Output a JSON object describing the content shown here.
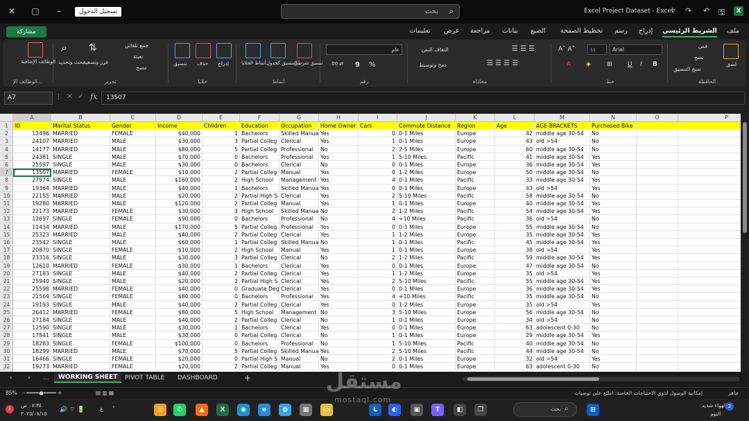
{
  "titlebar": {
    "sign_in": "تسجيل الدخول",
    "search_placeholder": "بحث",
    "doc_title": "Excel Project Dataset  -  Excel",
    "app_icon": "X"
  },
  "menu": {
    "share": "مشاركة",
    "tabs": [
      "ملف",
      "الشريط الرئيسي",
      "إدراج",
      "رسم",
      "تخطيط الصفحة",
      "الصيغ",
      "بيانات",
      "مراجعة",
      "عرض",
      "تعليمات"
    ],
    "active_tab": "الشريط الرئيسي"
  },
  "ribbon": {
    "clipboard": {
      "label": "الحافظة",
      "paste": "لصق",
      "cut": "قص",
      "copy": "نسخ",
      "format_painter": "نسخ التنسيق"
    },
    "font": {
      "label": "خط",
      "font_name": "Arial",
      "font_size": "١١",
      "bold": "B",
      "italic": "I",
      "underline": "U"
    },
    "alignment": {
      "label": "محاذاة",
      "wrap": "التفاف النص",
      "merge": "دمج وتوسيط"
    },
    "number": {
      "label": "رقم",
      "format": "عام",
      "percent": "%",
      "comma": "9"
    },
    "styles": {
      "label": "أنماط",
      "conditional": "تنسيق شرطي",
      "as_table": "التنسيق كجدول",
      "cell_styles": "أنماط الخلايا"
    },
    "cells": {
      "label": "خلايا",
      "insert": "إدراج",
      "delete": "حذف",
      "format": "تنسيق"
    },
    "editing": {
      "label": "تحرير",
      "autosum": "جمع تلقائي",
      "fill": "تعبئة",
      "clear": "مسح",
      "sort": "فرز وتصفية",
      "find": "بحث وتحديد"
    },
    "addins": {
      "label": "الوظائف الإ...",
      "addins": "الوظائف الإضافية"
    }
  },
  "formula_bar": {
    "name_box": "A7",
    "fx": "fx",
    "value": "13507"
  },
  "grid": {
    "columns": [
      "A",
      "B",
      "C",
      "D",
      "E",
      "F",
      "G",
      "H",
      "I",
      "J",
      "K",
      "L",
      "M",
      "N",
      "O",
      "P"
    ],
    "selected_column": "A",
    "selected_row": 7,
    "header_row": [
      "ID",
      "Marital Status",
      "Gender",
      "Income",
      "Children",
      "Education",
      "Occupation",
      "Home Owner",
      "Cars",
      "Commute Distance",
      "Region",
      "Age",
      "AGE-BRACKETS",
      "Purchased Bike"
    ],
    "data_rows": [
      [
        "12496",
        "MARRIED",
        "FEMALE",
        "$40,000",
        "1",
        "Bachelors",
        "Skilled Manua",
        "Yes",
        "0",
        "0-1 Miles",
        "Europe",
        "42",
        "middle age 30-54",
        "No"
      ],
      [
        "24107",
        "MARRIED",
        "MALE",
        "$30,000",
        "3",
        "Partial Colleg",
        "Clerical",
        "Yes",
        "1",
        "0-1 Miles",
        "Europe",
        "43",
        "old >54",
        "No"
      ],
      [
        "14177",
        "MARRIED",
        "MALE",
        "$80,000",
        "5",
        "Partial Colleg",
        "Professional",
        "No",
        "2",
        "2-5 Miles",
        "Europe",
        "60",
        "middle age 30-54",
        "No"
      ],
      [
        "24381",
        "SINGLE",
        "MALE",
        "$70,000",
        "0",
        "Bachelors",
        "Professional",
        "Yes",
        "1",
        "5-10 Miles",
        "Pacific",
        "41",
        "middle age 30-54",
        "Yes"
      ],
      [
        "25597",
        "SINGLE",
        "MALE",
        "$30,000",
        "0",
        "Bachelors",
        "Clerical",
        "No",
        "0",
        "0-1 Miles",
        "Europe",
        "36",
        "middle age 30-54",
        "Yes"
      ],
      [
        "13507",
        "MARRIED",
        "FEMALE",
        "$10,000",
        "2",
        "Partial Colleg",
        "Manual",
        "Yes",
        "0",
        "1-2 Miles",
        "Europe",
        "50",
        "middle age 30-54",
        "No"
      ],
      [
        "27974",
        "SINGLE",
        "MALE",
        "$160,000",
        "2",
        "High School",
        "Management",
        "Yes",
        "4",
        "0-1 Miles",
        "Pacific",
        "33",
        "middle age 30-54",
        "Yes"
      ],
      [
        "19364",
        "MARRIED",
        "MALE",
        "$40,000",
        "1",
        "Bachelors",
        "Skilled Manua",
        "Yes",
        "0",
        "0-1 Miles",
        "Europe",
        "43",
        "old >54",
        "Yes"
      ],
      [
        "22155",
        "MARRIED",
        "MALE",
        "$20,000",
        "2",
        "Partial High S",
        "Clerical",
        "Yes",
        "2",
        "5-10 Miles",
        "Pacific",
        "58",
        "middle age 30-54",
        "No"
      ],
      [
        "19280",
        "MARRIED",
        "MALE",
        "$120,000",
        "2",
        "Partial Colleg",
        "Manual",
        "Yes",
        "1",
        "0-1 Miles",
        "Europe",
        "40",
        "middle age 30-54",
        "Yes"
      ],
      [
        "22173",
        "MARRIED",
        "FEMALE",
        "$30,000",
        "3",
        "High School",
        "Skilled Manua",
        "No",
        "2",
        "1-2 Miles",
        "Pacific",
        "54",
        "middle age 30-54",
        "Yes"
      ],
      [
        "12697",
        "SINGLE",
        "FEMALE",
        "$90,000",
        "0",
        "Bachelors",
        "Professional",
        "No",
        "4",
        "+10 Miles",
        "Pacific",
        "36",
        "old >54",
        "No"
      ],
      [
        "11434",
        "MARRIED",
        "MALE",
        "$170,000",
        "5",
        "Partial Colleg",
        "Professional",
        "Yes",
        "0",
        "0-1 Miles",
        "Europe",
        "55",
        "middle age 30-54",
        "No"
      ],
      [
        "25323",
        "MARRIED",
        "MALE",
        "$40,000",
        "2",
        "Partial Colleg",
        "Clerical",
        "Yes",
        "1",
        "1-2 Miles",
        "Europe",
        "35",
        "middle age 30-54",
        "Yes"
      ],
      [
        "23542",
        "SINGLE",
        "MALE",
        "$60,000",
        "1",
        "Partial Colleg",
        "Skilled Manua",
        "No",
        "1",
        "0-1 Miles",
        "Pacific",
        "45",
        "middle age 30-54",
        "Yes"
      ],
      [
        "20870",
        "SINGLE",
        "FEMALE",
        "$10,000",
        "2",
        "High School",
        "Manual",
        "Yes",
        "1",
        "0-1 Miles",
        "Europe",
        "38",
        "old >54",
        "Yes"
      ],
      [
        "23316",
        "SINGLE",
        "MALE",
        "$30,000",
        "3",
        "Partial Colleg",
        "Clerical",
        "No",
        "2",
        "1-2 Miles",
        "Pacific",
        "59",
        "middle age 30-54",
        "Yes"
      ],
      [
        "12610",
        "MARRIED",
        "FEMALE",
        "$30,000",
        "1",
        "Bachelors",
        "Clerical",
        "Yes",
        "0",
        "0-1 Miles",
        "Europe",
        "47",
        "middle age 30-54",
        "No"
      ],
      [
        "27183",
        "SINGLE",
        "MALE",
        "$40,000",
        "2",
        "Partial Colleg",
        "Clerical",
        "Yes",
        "1",
        "1-2 Miles",
        "Europe",
        "35",
        "old >54",
        "Yes"
      ],
      [
        "25940",
        "SINGLE",
        "MALE",
        "$20,000",
        "2",
        "Partial High S",
        "Clerical",
        "Yes",
        "2",
        "5-10 Miles",
        "Pacific",
        "55",
        "middle age 30-54",
        "Yes"
      ],
      [
        "25598",
        "MARRIED",
        "FEMALE",
        "$40,000",
        "0",
        "Graduate Deg",
        "Clerical",
        "Yes",
        "0",
        "0-1 Miles",
        "Europe",
        "36",
        "middle age 30-54",
        "Yes"
      ],
      [
        "21564",
        "SINGLE",
        "FEMALE",
        "$80,000",
        "0",
        "Bachelors",
        "Professional",
        "Yes",
        "4",
        "+10 Miles",
        "Pacific",
        "35",
        "middle age 30-54",
        "No"
      ],
      [
        "19193",
        "SINGLE",
        "MALE",
        "$40,000",
        "2",
        "Partial Colleg",
        "Clerical",
        "Yes",
        "0",
        "1-2 Miles",
        "Europe",
        "35",
        "old >54",
        "Yes"
      ],
      [
        "26412",
        "MARRIED",
        "FEMALE",
        "$80,000",
        "5",
        "High School",
        "Management",
        "No",
        "3",
        "5-10 Miles",
        "Europe",
        "56",
        "middle age 30-54",
        "No"
      ],
      [
        "27184",
        "SINGLE",
        "MALE",
        "$40,000",
        "2",
        "Partial Colleg",
        "Clerical",
        "No",
        "1",
        "0-1 Miles",
        "Europe",
        "34",
        "old >54",
        "No"
      ],
      [
        "12590",
        "SINGLE",
        "MALE",
        "$30,000",
        "1",
        "Bachelors",
        "Clerical",
        "Yes",
        "0",
        "0-1 Miles",
        "Europe",
        "63",
        "adolescent 0-30",
        "No"
      ],
      [
        "17841",
        "SINGLE",
        "MALE",
        "$30,000",
        "0",
        "Partial Colleg",
        "Clerical",
        "No",
        "1",
        "0-1 Miles",
        "Europe",
        "29",
        "middle age 30-54",
        "Yes"
      ],
      [
        "18283",
        "SINGLE",
        "FEMALE",
        "$100,000",
        "0",
        "Bachelors",
        "Professional",
        "No",
        "1",
        "5-10 Miles",
        "Pacific",
        "40",
        "middle age 30-54",
        "No"
      ],
      [
        "18299",
        "MARRIED",
        "MALE",
        "$70,000",
        "5",
        "Partial Colleg",
        "Skilled Manua",
        "Yes",
        "2",
        "5-10 Miles",
        "Pacific",
        "44",
        "middle age 30-54",
        "No"
      ],
      [
        "16466",
        "SINGLE",
        "FEMALE",
        "$20,000",
        "0",
        "Partial High S",
        "Manual",
        "No",
        "2",
        "0-1 Miles",
        "Europe",
        "32",
        "old >54",
        "Yes"
      ],
      [
        "19273",
        "MARRIED",
        "FEMALE",
        "$20,000",
        "2",
        "Partial Colleg",
        "Manual",
        "Yes",
        "0",
        "0-1 Miles",
        "Europe",
        "63",
        "adolescent 0-30",
        "No"
      ]
    ]
  },
  "sheets": {
    "tabs": [
      "WORKING SHEET",
      "PIVOT TABLE",
      "DASHBOARD"
    ],
    "active": "WORKING SHEET",
    "add": "+",
    "more": "..."
  },
  "status": {
    "ready": "جاهز",
    "accessibility": "إمكانية الوصول لذوي الاحتياجات الخاصة: اطلع على توصيات",
    "zoom": "85%"
  },
  "taskbar": {
    "search": "بحث",
    "weather": "الهواء شديد",
    "weather_sub": "اليوم",
    "time": "٠٧:٣٤ ص",
    "date": "٢٠٢٥/٠٨/١٥",
    "lang": "ع",
    "notif_count": "2"
  },
  "watermark": {
    "brand": "مستقل",
    "domain": "mostaql.com"
  }
}
